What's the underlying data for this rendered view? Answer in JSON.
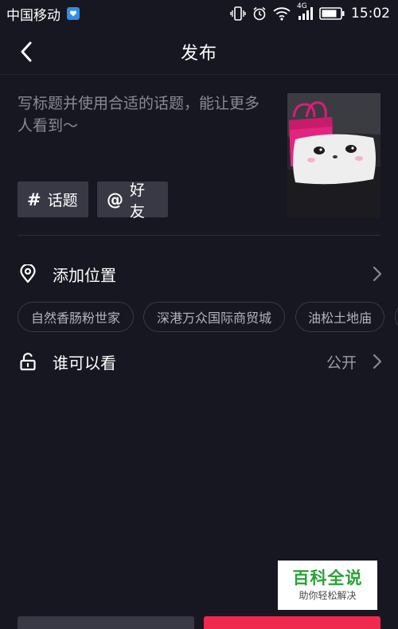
{
  "status_bar": {
    "carrier": "中国移动",
    "network": "4G",
    "time": "15:02"
  },
  "header": {
    "title": "发布"
  },
  "caption": {
    "placeholder": "写标题并使用合适的话题，能让更多人看到～"
  },
  "tags": {
    "topic_symbol": "#",
    "topic_label": "话题",
    "friend_symbol": "@",
    "friend_label": "好友"
  },
  "location": {
    "label": "添加位置",
    "suggestions": [
      "自然香肠粉世家",
      "深港万众国际商贸城",
      "油松土地庙"
    ]
  },
  "visibility": {
    "label": "谁可以看",
    "value": "公开"
  },
  "watermark": {
    "title": "百科全说",
    "subtitle": "助你轻松解决"
  },
  "colors": {
    "background": "#171722",
    "accent": "#f0294f",
    "button_bg": "#393945",
    "watermark_green": "#2aa137"
  },
  "icons": [
    "back-chevron-icon",
    "location-pin-icon",
    "unlock-icon",
    "chevron-right-icon"
  ]
}
